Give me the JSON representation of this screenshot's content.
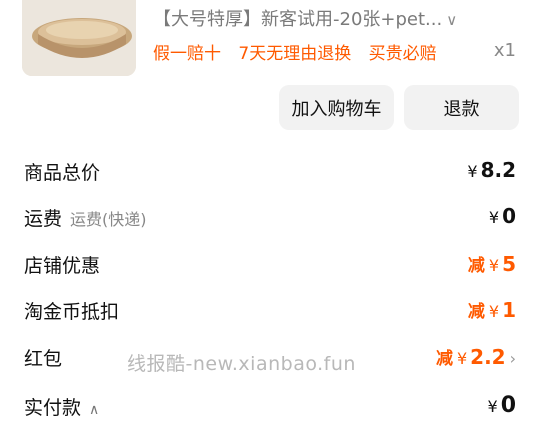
{
  "product": {
    "title": "【大号特厚】新客试用-20张+pet...",
    "tags": [
      "假一赔十",
      "7天无理由退换",
      "买贵必赔"
    ],
    "quantity": "x1"
  },
  "actions": {
    "add_to_cart": "加入购物车",
    "refund": "退款"
  },
  "currency": "¥",
  "summary": {
    "goods_total": {
      "label": "商品总价",
      "value": "8.2"
    },
    "shipping": {
      "label": "运费",
      "sub": "运费(快递)",
      "value": "0"
    },
    "store_discount": {
      "label": "店铺优惠",
      "prefix": "减",
      "value": "5"
    },
    "coin_deduction": {
      "label": "淘金币抵扣",
      "prefix": "减",
      "value": "1"
    },
    "red_packet": {
      "label": "红包",
      "prefix": "减",
      "value": "2.2"
    },
    "paid": {
      "label": "实付款",
      "value": "0"
    }
  },
  "watermark": "线报酷-new.xianbao.fun",
  "colors": {
    "accent": "#ff5a00",
    "button_bg": "#f2f2f2",
    "muted": "#888888"
  }
}
